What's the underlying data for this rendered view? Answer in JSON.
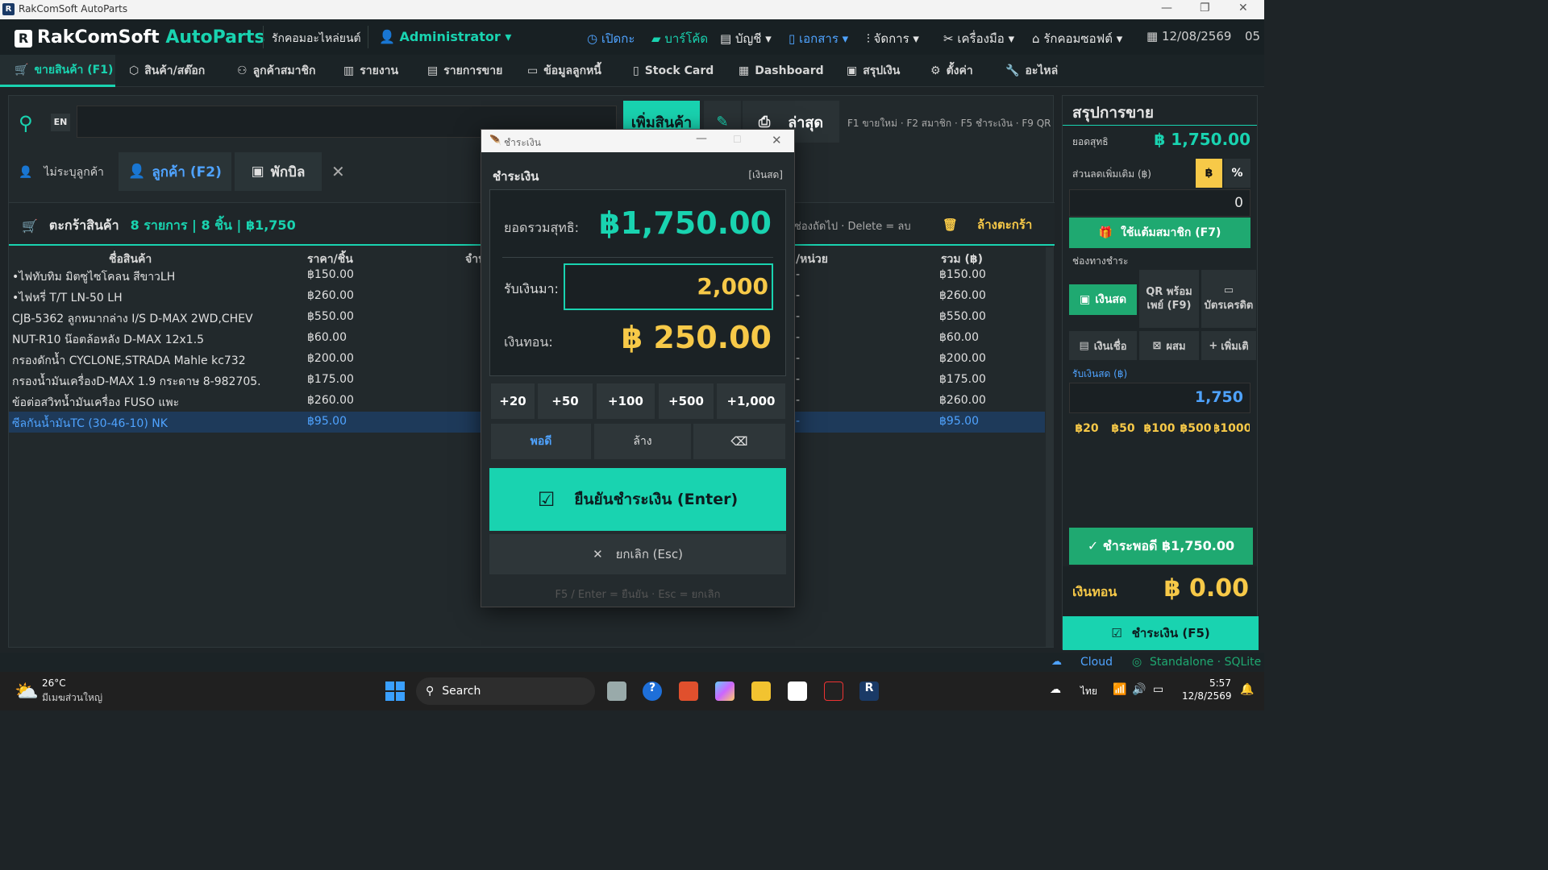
{
  "window": {
    "title": "RakComSoft AutoParts"
  },
  "header": {
    "brand_main": "RakComSoft ",
    "brand_accent": "AutoParts",
    "shop": "รักคอมอะไหล่ยนต์",
    "user": "Administrator",
    "items": [
      "เปิดกะ",
      "บาร์โค้ด",
      "บัญชี",
      "เอกสาร",
      "จัดการ",
      "เครื่องมือ",
      "รักคอมซอฟต์"
    ],
    "date": "12/08/2569",
    "time_cut": "05"
  },
  "nav": {
    "tabs": [
      "ขายสินค้า (F1)",
      "สินค้า/สต๊อก",
      "ลูกค้าสมาชิก",
      "รายงาน",
      "รายการขาย",
      "ข้อมูลลูกหนี้",
      "Stock Card",
      "Dashboard",
      "สรุปเงิน",
      "ตั้งค่า",
      "อะไหล่"
    ]
  },
  "search": {
    "lang": "EN",
    "add_button": "เพิ่มสินค้า",
    "latest_button": "ล่าสุด",
    "hint": "F1 ขายใหม่ · F2 สมาชิก · F5 ชำระเงิน · F9 QR"
  },
  "customer": {
    "no_customer": "ไม่ระบุลูกค้า",
    "customer_btn": "ลูกค้า (F2)",
    "hold_btn": "พักบิล"
  },
  "cart": {
    "label": "ตะกร้าสินค้า",
    "summary": "8 รายการ | 8 ชิ้น | ฿1,750",
    "hint": "ช่องถัดไป · Delete = ลบ",
    "clear": "ล้างตะกร้า",
    "columns": [
      "ชื่อสินค้า",
      "ราคา/ชิ้น",
      "จำน",
      "/หน่วย",
      "รวม (฿)"
    ],
    "rows": [
      {
        "name": "•ไฟทับทิม มิตซูไซโคลน สีขาวLH",
        "price": "฿150.00",
        "dash": "-",
        "total": "฿150.00"
      },
      {
        "name": "•ไฟหรี่ T/T LN-50 LH",
        "price": "฿260.00",
        "dash": "-",
        "total": "฿260.00"
      },
      {
        "name": "CJB-5362 ลูกหมากล่าง I/S D-MAX 2WD,CHEV",
        "price": "฿550.00",
        "dash": "-",
        "total": "฿550.00"
      },
      {
        "name": "NUT-R10 น๊อตล้อหลัง D-MAX 12x1.5",
        "price": "฿60.00",
        "dash": "-",
        "total": "฿60.00"
      },
      {
        "name": "กรองดักน้ำ CYCLONE,STRADA Mahle kc732",
        "price": "฿200.00",
        "dash": "-",
        "total": "฿200.00"
      },
      {
        "name": "กรองน้ำมันเครื่องD-MAX 1.9 กระดาษ 8-982705.",
        "price": "฿175.00",
        "dash": "-",
        "total": "฿175.00"
      },
      {
        "name": "ข้อต่อสวิทน้ำมันเครื่อง FUSO แพะ",
        "price": "฿260.00",
        "dash": "-",
        "total": "฿260.00"
      },
      {
        "name": "ซีลกันน้ำมันTC (30-46-10) NK",
        "price": "฿95.00",
        "dash": "-",
        "total": "฿95.00"
      }
    ]
  },
  "summary": {
    "title": "สรุปการขาย",
    "net_label": "ยอดสุทธิ",
    "net_value": "฿ 1,750.00",
    "discount_label": "ส่วนลดเพิ่มเติม (฿)",
    "baht": "฿",
    "percent": "%",
    "discount_value": "0",
    "points_btn": "ใช้แต้มสมาชิก (F7)",
    "pay_channel": "ช่องทางชำระ",
    "cash": "เงินสด",
    "qr": "QR พร้อมเพย์ (F9)",
    "card": "บัตรเครดิต",
    "credit": "เงินเชื่อ",
    "mixed": "ผสม",
    "more": "เพิ่มเติ",
    "received_label": "รับเงินสด (฿)",
    "received_value": "1,750",
    "quick": [
      "฿20",
      "฿50",
      "฿100",
      "฿500",
      "฿1000"
    ],
    "exact_btn": "✓  ชำระพอดี ฿1,750.00",
    "change_label": "เงินทอน",
    "change_value": "฿ 0.00",
    "pay_btn": "ชำระเงิน (F5)"
  },
  "dialog": {
    "window_title": "ชำระเงิน",
    "heading": "ชำระเงิน",
    "method": "[เงินสด]",
    "total_label": "ยอดรวมสุทธิ:",
    "total_value": "฿1,750.00",
    "received_label": "รับเงินมา:",
    "received_value": "2,000",
    "change_label": "เงินทอน:",
    "change_value": "฿ 250.00",
    "quick": [
      "+20",
      "+50",
      "+100",
      "+500",
      "+1,000"
    ],
    "exact": "พอดี",
    "clear": "ล้าง",
    "backspace": "⌫",
    "confirm": "ยืนยันชำระเงิน   (Enter)",
    "cancel": "ยกเลิก   (Esc)",
    "footer": "F5 / Enter = ยืนยัน  ·  Esc = ยกเลิก"
  },
  "status": {
    "cloud": "Cloud",
    "mode": "Standalone · SQLite"
  },
  "taskbar": {
    "temp": "26°C",
    "weather": "มีเมฆส่วนใหญ่",
    "search": "Search",
    "lang": "ไทย",
    "time": "5:57",
    "date": "12/8/2569"
  },
  "colors": {
    "accent": "#19d3b0",
    "gold": "#f7c948",
    "button": "#1fa971",
    "selected": "#1e3a5a"
  }
}
